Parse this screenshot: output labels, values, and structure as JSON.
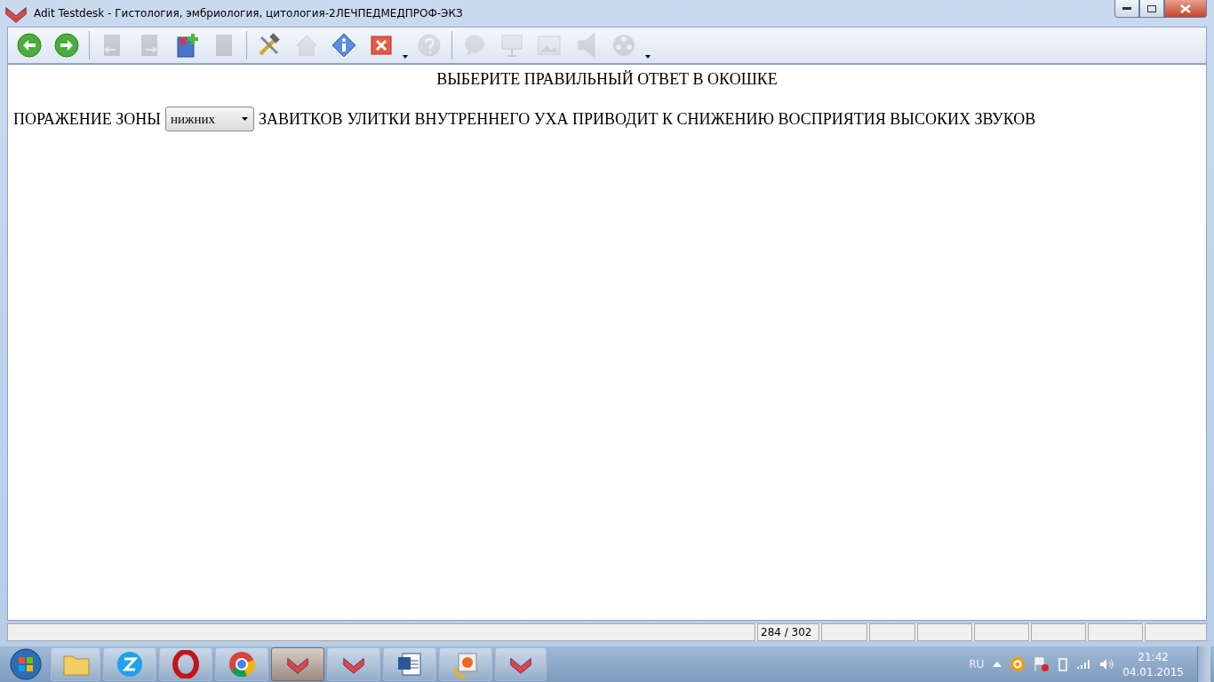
{
  "window": {
    "title": "Adit Testdesk - Гистология, эмбриология, цитология-2ЛЕЧПЕДМЕДПРОФ-ЭКЗ"
  },
  "toolbar": [
    {
      "kind": "back",
      "disabled": false
    },
    {
      "kind": "forward",
      "disabled": false
    },
    {
      "kind": "separator"
    },
    {
      "kind": "book-prev",
      "disabled": true
    },
    {
      "kind": "book-next",
      "disabled": true
    },
    {
      "kind": "book-add",
      "disabled": false
    },
    {
      "kind": "book",
      "disabled": true
    },
    {
      "kind": "separator"
    },
    {
      "kind": "tools",
      "disabled": false
    },
    {
      "kind": "home",
      "disabled": true
    },
    {
      "kind": "info",
      "disabled": false
    },
    {
      "kind": "close",
      "disabled": false
    },
    {
      "kind": "menu"
    },
    {
      "kind": "help",
      "disabled": true
    },
    {
      "kind": "separator"
    },
    {
      "kind": "hint",
      "disabled": true
    },
    {
      "kind": "presentation",
      "disabled": true
    },
    {
      "kind": "image",
      "disabled": true
    },
    {
      "kind": "sound",
      "disabled": true
    },
    {
      "kind": "video",
      "disabled": true
    },
    {
      "kind": "menu"
    }
  ],
  "question": {
    "instruction": "ВЫБЕРИТЕ ПРАВИЛЬНЫЙ ОТВЕТ В ОКОШКЕ",
    "before": "ПОРАЖЕНИЕ ЗОНЫ",
    "answer": "нижних",
    "after": "ЗАВИТКОВ УЛИТКИ ВНУТРЕННЕГО УХА ПРИВОДИТ К СНИЖЕНИЮ ВОСПРИЯТИЯ ВЫСОКИХ ЗВУКОВ"
  },
  "status_bar": {
    "counter": "284 / 302"
  },
  "taskbar": {
    "items": [
      {
        "kind": "folder",
        "selected": false
      },
      {
        "kind": "z",
        "selected": false
      },
      {
        "kind": "opera",
        "selected": false
      },
      {
        "kind": "chrome",
        "selected": false
      },
      {
        "kind": "testdesk",
        "selected": true
      },
      {
        "kind": "testdesk",
        "selected": false
      },
      {
        "kind": "word",
        "selected": false
      },
      {
        "kind": "paint",
        "selected": false
      },
      {
        "kind": "testdesk",
        "selected": false
      }
    ],
    "language": "RU",
    "time": "21:42",
    "date": "04.01.2015"
  }
}
